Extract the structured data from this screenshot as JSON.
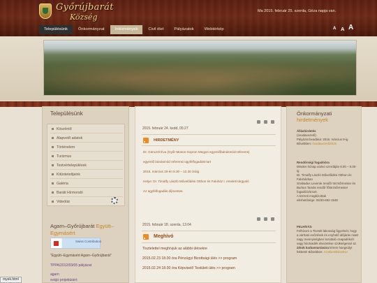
{
  "header": {
    "title_line1": "Győrújbarát",
    "title_line2": "Község",
    "date_text": "Ma 2015. február 25. szerda, Géza napja van.",
    "font_sizes": [
      "A",
      "A",
      "A"
    ]
  },
  "nav": {
    "items": [
      {
        "label": "Településünk"
      },
      {
        "label": "Önkormányzat"
      },
      {
        "label": "Intézmények"
      },
      {
        "label": "Civil élet"
      },
      {
        "label": "Pályázatok"
      },
      {
        "label": "Webtérkép"
      }
    ]
  },
  "left": {
    "title": "Településünk",
    "menu": [
      "Köszöntő",
      "Alapvető adatok",
      "Történelem",
      "Turizmus",
      "Testvértelepülések",
      "Kitüntetettjeink",
      "Galéria",
      "Baráti Hírmondó",
      "Videótár"
    ],
    "agarn_title_plain": "Agarn–Győrújbarát",
    "agarn_title_hl1": "Együtt–",
    "agarn_title_hl2": "Egymásért",
    "flag_text": "Swiss Contribution",
    "agarn_sub": "\"Együtt–Egymásért Agarn–Győrújbarát\"",
    "tppa": "TPPA/2012/03/05 pályázat",
    "line1": "agarn",
    "line2": "svájci projektzáró"
  },
  "center": {
    "post1": {
      "date": "2015. február 24. kedd, 05:27",
      "heading": "HIRDETMÉNY",
      "lines": [
        "Dr. Gönczöl Éva (Győr-Moson-Sopron Megyei egyenlőbánásmód-referens)",
        "egyenlő bánásmód referensi ügyfélfogadást tart",
        "2015. március 19-én 8.30 – 12.30 óráig",
        "Helye: Dr. Timaffy László Művelődési Otthon és Faluház I. emeleti tárgyaló",
        "Az ügyfélfogadás díjmentes."
      ]
    },
    "post2": {
      "date": "2015. február 18. szerda, 13:04",
      "heading": "Meghívó",
      "lines": [
        "Tisztelettel meghívjuk az alábbi ülésekre",
        "2015.02.23 18.00 óra Pénzügyi Bizottsági ülés  >> program",
        "2015.02.24 18.00 óra Képviselő Testületi ülés  >> program"
      ]
    }
  },
  "right": {
    "title1": "Önkormányzati",
    "title2": "hirdetmények",
    "blocks": [
      {
        "bold": "Álláshirdetés",
        "text": "(óvodavezető)\nPályázat beadása: 2015. március 9-ig\nBővebben:",
        "link": "óvodavezető2015"
      },
      {
        "bold": "Rendőrségi fogadóóra",
        "text": "Minden hónap utolsó szerdáján 8.00 – 9.00-ig\nDr. Timaffy László Művelődési Otthon és Faluházban\nSzabadus Levente rendőr törzsőrmester és\nBurkus Tamás rendőr főtörzsőrmester fogadóórát tart.\nA körzeti megbízottak\nelérhetősége: 06/30-692-1548",
        "link": ""
      },
      {
        "bold": "FELHÍVÁS",
        "text": "Felhívom a Tisztelt lakosság figyelmét, hogy a várható esőzések és enyhülő időjárás miatt nagy mennyiségben lezúduló csapadékvíz vagy hóolvadék elvezetése szükségessé az",
        "link": ""
      }
    ],
    "bold2": "árkok karbantartására",
    "tail": "kérem hangsúlyt fektetni! Bővebben:",
    "tail_link": "Árokbetöltés2014"
  },
  "status": {
    "text": "myek.html"
  }
}
